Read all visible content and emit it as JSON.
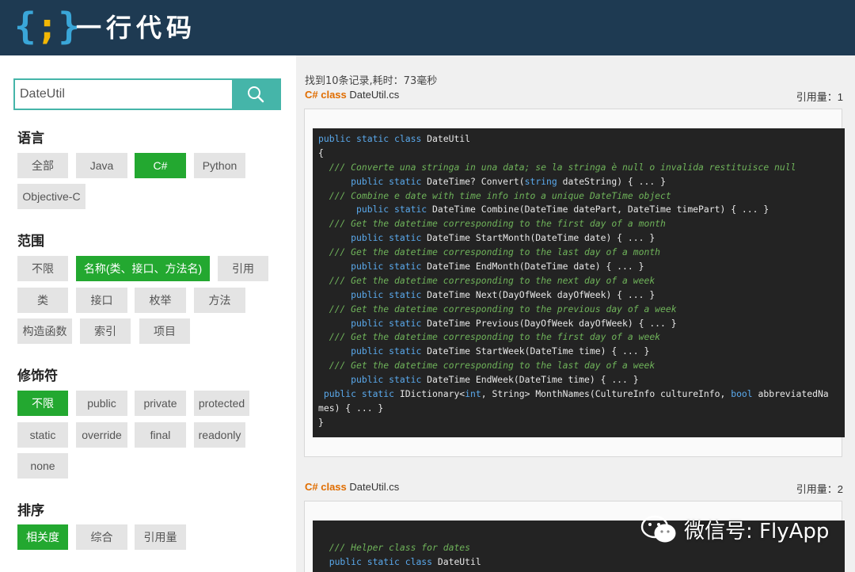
{
  "header": {
    "logo_brace": "{;}",
    "logo_text": "一行代码"
  },
  "search": {
    "value": "DateUtil",
    "placeholder": ""
  },
  "filters": {
    "language": {
      "title": "语言",
      "options": [
        "全部",
        "Java",
        "C#",
        "Python",
        "Objective-C"
      ],
      "selected": "C#"
    },
    "scope": {
      "title": "范围",
      "options": [
        "不限",
        "名称(类、接口、方法名)",
        "引用",
        "类",
        "接口",
        "枚举",
        "方法",
        "构造函数",
        "索引",
        "项目"
      ],
      "selected": "名称(类、接口、方法名)"
    },
    "modifier": {
      "title": "修饰符",
      "options": [
        "不限",
        "public",
        "private",
        "protected",
        "static",
        "override",
        "final",
        "readonly",
        "none"
      ],
      "selected": "不限"
    },
    "sort": {
      "title": "排序",
      "options": [
        "相关度",
        "综合",
        "引用量"
      ],
      "selected": "相关度"
    }
  },
  "results": {
    "summary": "找到10条记录,耗时：73毫秒",
    "items": [
      {
        "kind": "C# class",
        "file": "DateUtil.cs",
        "refs": "引用量：1",
        "code": [
          [
            [
              "public static class ",
              "kw"
            ],
            [
              "DateUtil",
              ""
            ]
          ],
          [
            [
              "{",
              ""
            ]
          ],
          [
            [
              "  /// Converte una stringa in una data; se la stringa è null o invalida restituisce null",
              "cm"
            ]
          ],
          [
            [
              "      public static ",
              "kw"
            ],
            [
              "DateTime? Convert(",
              ""
            ],
            [
              "string",
              "kw"
            ],
            [
              " dateString) { ... }",
              ""
            ]
          ],
          [
            [
              "  /// Combine e date with time info into a unique DateTime object",
              "cm"
            ]
          ],
          [
            [
              "       public static ",
              "kw"
            ],
            [
              "DateTime Combine(DateTime datePart, DateTime timePart) { ... }",
              ""
            ]
          ],
          [
            [
              "  /// Get the datetime corresponding to the first day of a month",
              "cm"
            ]
          ],
          [
            [
              "      public static ",
              "kw"
            ],
            [
              "DateTime StartMonth(DateTime date) { ... }",
              ""
            ]
          ],
          [
            [
              "  /// Get the datetime corresponding to the last day of a month",
              "cm"
            ]
          ],
          [
            [
              "      public static ",
              "kw"
            ],
            [
              "DateTime EndMonth(DateTime date) { ... }",
              ""
            ]
          ],
          [
            [
              "  /// Get the datetime corresponding to the next day of a week",
              "cm"
            ]
          ],
          [
            [
              "      public static ",
              "kw"
            ],
            [
              "DateTime Next(DayOfWeek dayOfWeek) { ... }",
              ""
            ]
          ],
          [
            [
              "  /// Get the datetime corresponding to the previous day of a week",
              "cm"
            ]
          ],
          [
            [
              "      public static ",
              "kw"
            ],
            [
              "DateTime Previous(DayOfWeek dayOfWeek) { ... }",
              ""
            ]
          ],
          [
            [
              "  /// Get the datetime corresponding to the first day of a week",
              "cm"
            ]
          ],
          [
            [
              "      public static ",
              "kw"
            ],
            [
              "DateTime StartWeek(DateTime time) { ... }",
              ""
            ]
          ],
          [
            [
              "  /// Get the datetime corresponding to the last day of a week",
              "cm"
            ]
          ],
          [
            [
              "      public static ",
              "kw"
            ],
            [
              "DateTime EndWeek(DateTime time) { ... }",
              ""
            ]
          ],
          [
            [
              " public static ",
              "kw"
            ],
            [
              "IDictionary<",
              ""
            ],
            [
              "int",
              "kw"
            ],
            [
              ", String> MonthNames(CultureInfo cultureInfo, ",
              ""
            ],
            [
              "bool",
              "kw"
            ],
            [
              " abbreviatedNa",
              ""
            ]
          ],
          [
            [
              "mes) { ... }",
              ""
            ]
          ],
          [
            [
              "}",
              ""
            ]
          ]
        ]
      },
      {
        "kind": "C# class",
        "file": "DateUtil.cs",
        "refs": "引用量：2",
        "code": [
          [
            [
              "",
              ""
            ]
          ],
          [
            [
              "  /// Helper class for dates",
              "cm"
            ]
          ],
          [
            [
              "  public static class ",
              "kw"
            ],
            [
              "DateUtil",
              ""
            ]
          ],
          [
            [
              "{",
              ""
            ]
          ]
        ]
      }
    ]
  },
  "watermark": {
    "icon": "wechat-icon",
    "text": "微信号: FlyApp"
  },
  "colors": {
    "header_bg": "#1e3a52",
    "accent_teal": "#45b5a9",
    "active_green": "#23a830",
    "kind_orange": "#e06d00",
    "code_bg": "#232323"
  }
}
